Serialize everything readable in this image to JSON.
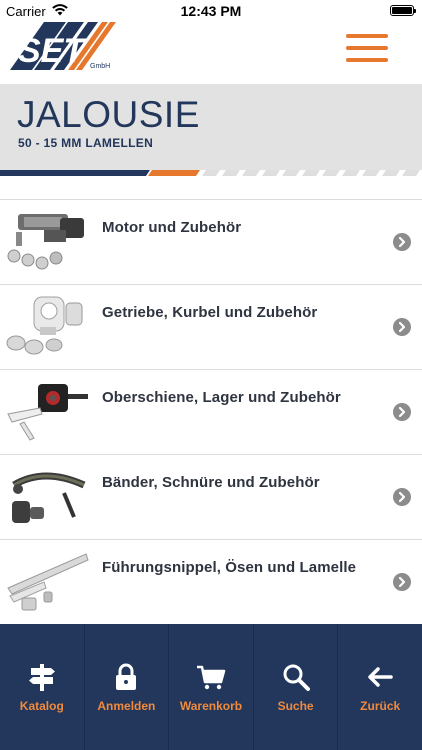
{
  "status_bar": {
    "carrier": "Carrier",
    "time": "12:43 PM"
  },
  "header": {
    "logo_text": "SET",
    "logo_suffix": "GmbH",
    "menu_icon": "hamburger-menu-icon",
    "accent_color": "#e6782e"
  },
  "banner": {
    "title": "JALOUSIE",
    "subtitle": "50 - 15 MM LAMELLEN",
    "title_color": "#23375c"
  },
  "categories": [
    {
      "label": "Motor und Zubehör",
      "icon": "motor-parts-image"
    },
    {
      "label": "Getriebe, Kurbel und Zubehör",
      "icon": "gearbox-parts-image"
    },
    {
      "label": "Oberschiene, Lager und Zubehör",
      "icon": "rail-bearing-image"
    },
    {
      "label": "Bänder, Schnüre und Zubehör",
      "icon": "strap-cord-image"
    },
    {
      "label": "Führungsnippel, Ösen und Lamelle",
      "icon": "guide-slat-image"
    }
  ],
  "bottom_nav": {
    "background": "#23375c",
    "label_color": "#f08a3c",
    "items": [
      {
        "label": "Katalog",
        "icon": "signpost-icon"
      },
      {
        "label": "Anmelden",
        "icon": "lock-icon"
      },
      {
        "label": "Warenkorb",
        "icon": "cart-icon"
      },
      {
        "label": "Suche",
        "icon": "search-icon"
      },
      {
        "label": "Zurück",
        "icon": "arrow-left-icon"
      }
    ]
  }
}
